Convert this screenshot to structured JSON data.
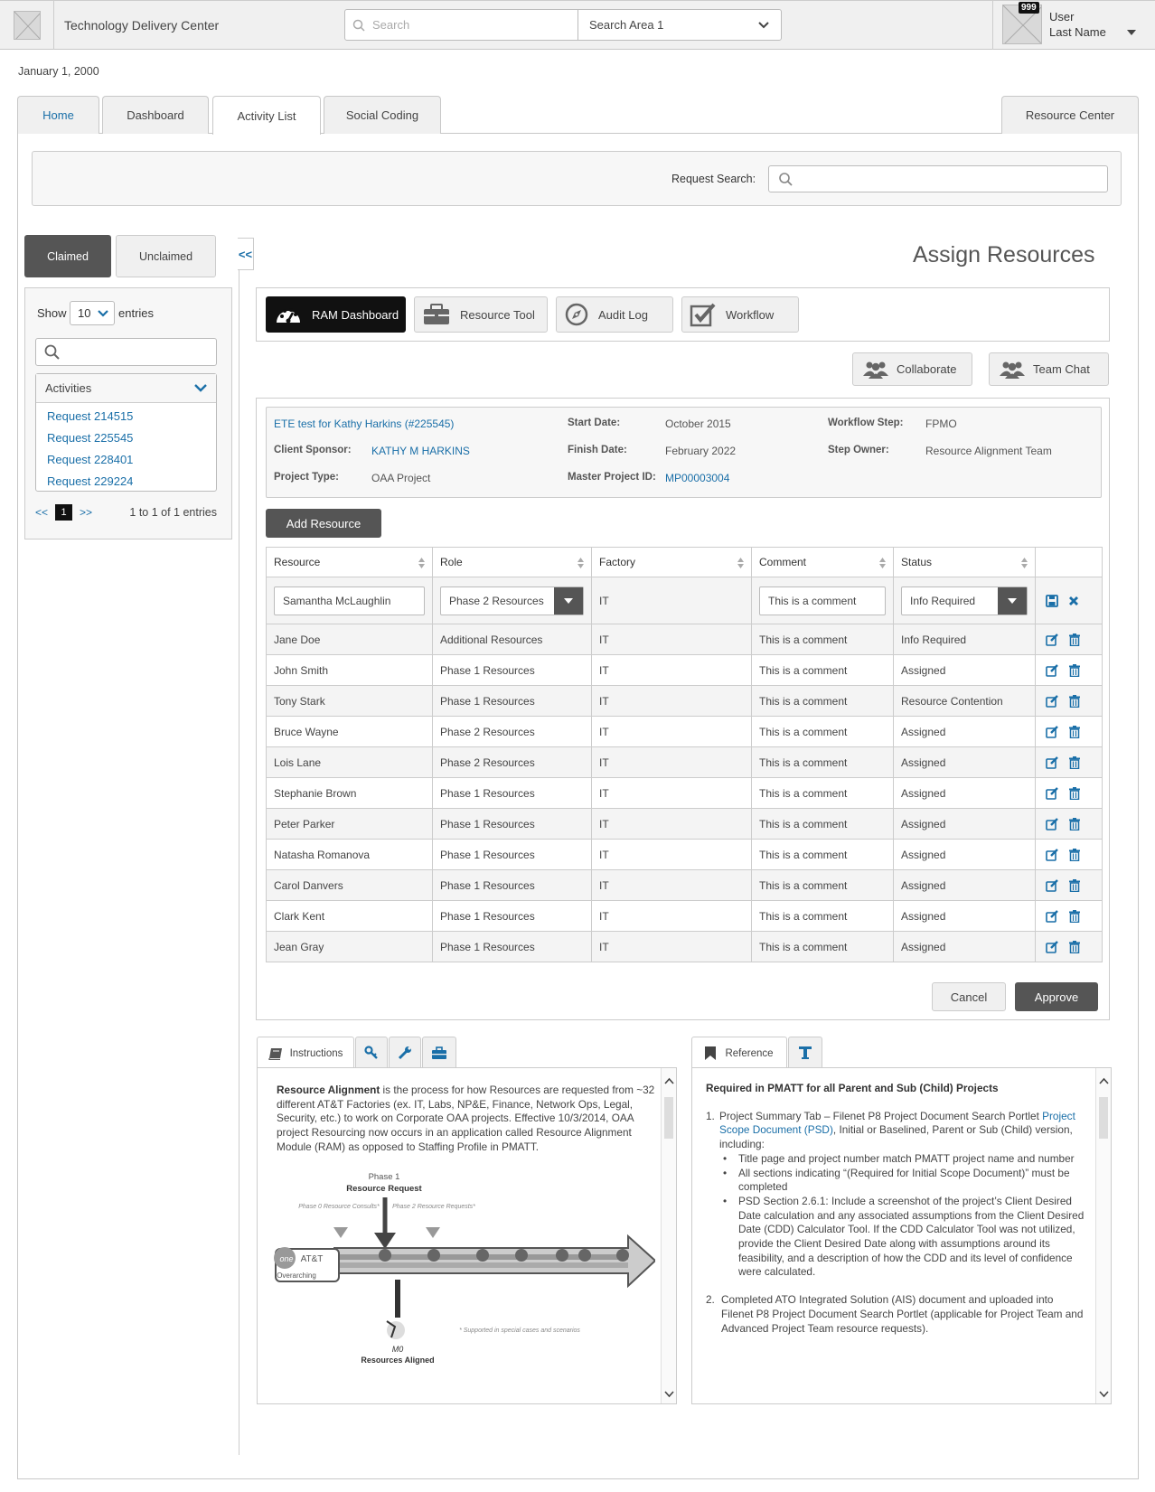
{
  "header": {
    "app_title": "Technology Delivery Center",
    "search_placeholder": "Search",
    "search_area": "Search Area 1",
    "notification_count": "999",
    "user_first": "User",
    "user_last": "Last Name"
  },
  "date": "January 1, 2000",
  "tabs": {
    "home": "Home",
    "dashboard": "Dashboard",
    "activity_list": "Activity List",
    "social_coding": "Social Coding",
    "resource_center": "Resource Center"
  },
  "request_search": {
    "label": "Request Search:"
  },
  "sidebar": {
    "claimed": "Claimed",
    "unclaimed": "Unclaimed",
    "collapse": "<<",
    "show_label": "Show",
    "show_value": "10",
    "entries_label": "entries",
    "activities_label": "Activities",
    "requests": [
      "Request 214515",
      "Request 225545",
      "Request 228401",
      "Request 229224"
    ],
    "pager_prev": "<<",
    "pager_page": "1",
    "pager_next": ">>",
    "pager_info": "1 to 1 of 1 entries"
  },
  "main": {
    "heading": "Assign Resources",
    "toolbar": {
      "ram_dashboard": "RAM Dashboard",
      "resource_tool": "Resource Tool",
      "audit_log": "Audit Log",
      "workflow": "Workflow"
    },
    "collaborate": "Collaborate",
    "team_chat": "Team Chat",
    "project": {
      "name": "ETE test for Kathy Harkins (#225545)",
      "client_sponsor_label": "Client Sponsor:",
      "client_sponsor": "KATHY M HARKINS",
      "project_type_label": "Project Type:",
      "project_type": "OAA Project",
      "start_date_label": "Start Date:",
      "start_date": "October 2015",
      "finish_date_label": "Finish Date:",
      "finish_date": "February 2022",
      "master_id_label": "Master Project ID:",
      "master_id": "MP00003004",
      "workflow_step_label": "Workflow Step:",
      "workflow_step": "FPMO",
      "step_owner_label": "Step Owner:",
      "step_owner": "Resource Alignment Team"
    },
    "add_resource": "Add Resource",
    "table": {
      "headers": {
        "resource": "Resource",
        "role": "Role",
        "factory": "Factory",
        "comment": "Comment",
        "status": "Status"
      },
      "edit_row": {
        "resource": "Samantha McLaughlin",
        "role": "Phase 2 Resources",
        "factory": "IT",
        "comment": "This is a comment",
        "status": "Info Required"
      },
      "rows": [
        {
          "resource": "Jane Doe",
          "role": "Additional Resources",
          "factory": "IT",
          "comment": "This is a comment",
          "status": "Info Required"
        },
        {
          "resource": "John Smith",
          "role": "Phase 1 Resources",
          "factory": "IT",
          "comment": "This is a comment",
          "status": "Assigned"
        },
        {
          "resource": "Tony Stark",
          "role": "Phase 1 Resources",
          "factory": "IT",
          "comment": "This is a comment",
          "status": "Resource Contention"
        },
        {
          "resource": "Bruce Wayne",
          "role": "Phase 2 Resources",
          "factory": "IT",
          "comment": "This is a comment",
          "status": "Assigned"
        },
        {
          "resource": "Lois Lane",
          "role": "Phase 2 Resources",
          "factory": "IT",
          "comment": "This is a comment",
          "status": "Assigned"
        },
        {
          "resource": "Stephanie Brown",
          "role": "Phase 1 Resources",
          "factory": "IT",
          "comment": "This is a comment",
          "status": "Assigned"
        },
        {
          "resource": "Peter Parker",
          "role": "Phase 1 Resources",
          "factory": "IT",
          "comment": "This is a comment",
          "status": "Assigned"
        },
        {
          "resource": "Natasha Romanova",
          "role": "Phase 1 Resources",
          "factory": "IT",
          "comment": "This is a comment",
          "status": "Assigned"
        },
        {
          "resource": "Carol Danvers",
          "role": "Phase 1 Resources",
          "factory": "IT",
          "comment": "This is a comment",
          "status": "Assigned"
        },
        {
          "resource": "Clark Kent",
          "role": "Phase 1 Resources",
          "factory": "IT",
          "comment": "This is a comment",
          "status": "Assigned"
        },
        {
          "resource": "Jean Gray",
          "role": "Phase 1 Resources",
          "factory": "IT",
          "comment": "This is a comment",
          "status": "Assigned"
        }
      ]
    },
    "cancel": "Cancel",
    "approve": "Approve"
  },
  "instructions": {
    "tab": "Instructions",
    "bold": "Resource Alignment",
    "text": " is the process for how Resources are requested from ~32 different AT&T Factories (ex. IT, Labs, NP&E, Finance, Network Ops, Legal, Security, etc.) to work on Corporate OAA projects. Effective 10/3/2014, OAA project Resourcing now occurs in an application called Resource Alignment Module (RAM) as opposed to Staffing Profile in PMATT.",
    "diagram": {
      "phase1": "Phase 1",
      "resource_request": "Resource Request",
      "phase0": "Phase 0 Resource Consults*",
      "phase2": "Phase 2 Resource Requests*",
      "att": "AT&T",
      "overarching": "Overarching",
      "m0": "M0",
      "resources_aligned": "Resources Aligned",
      "footnote": "* Supported in special cases and scenarios"
    }
  },
  "reference": {
    "tab": "Reference",
    "title": "Required in PMATT for all Parent and Sub (Child) Projects",
    "item1_prefix": "Project Summary Tab – Filenet P8 Project Document Search Portlet ",
    "item1_link": "Project Scope Document (PSD)",
    "item1_suffix": ", Initial or Baselined, Parent or Sub (Child) version, including:",
    "bullets": [
      "Title page and project number match PMATT project name and number",
      "All sections indicating “(Required for Initial Scope Document)” must be completed",
      "PSD Section 2.6.1: Include a screenshot of the project’s Client Desired Date calculation and any associated assumptions from the Client Desired Date (CDD) Calculator Tool. If the CDD Calculator Tool was not utilized, provide the Client Desired Date along with assumptions around its feasibility, and a description of how the CDD and its level of confidence were calculated."
    ],
    "item2": "Completed ATO Integrated Solution (AIS) document and uploaded into Filenet P8 Project Document Search Portlet (applicable for Project Team and Advanced Project Team resource requests)."
  }
}
